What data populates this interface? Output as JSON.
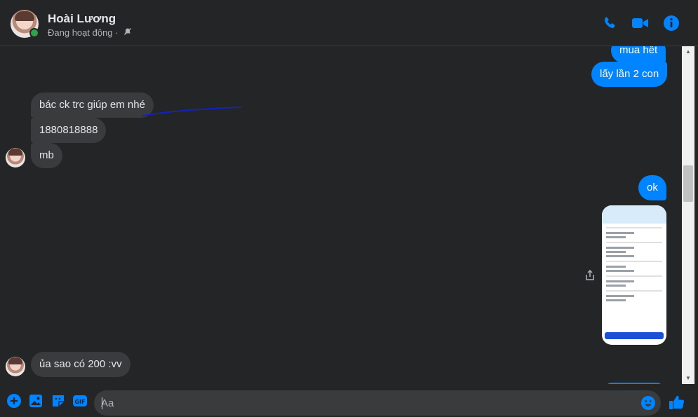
{
  "header": {
    "name": "Hoài Lương",
    "status": "Đang hoạt động ·",
    "icons": [
      "phone-icon",
      "video-camera-icon",
      "info-icon"
    ],
    "accent": "#0084ff"
  },
  "messages": [
    {
      "side": "out",
      "text": "mua hết"
    },
    {
      "side": "out",
      "text": "lấy lần 2 con"
    },
    {
      "side": "in",
      "text": "bác ck trc giúp em nhé"
    },
    {
      "side": "in",
      "text": "1880818888"
    },
    {
      "side": "in",
      "text": "mb"
    },
    {
      "side": "out",
      "text": "ok"
    },
    {
      "side": "in",
      "text": "ủa sao có 200 :vv"
    }
  ],
  "composer": {
    "placeholder": "Aa",
    "icons": [
      "plus-icon",
      "photo-icon",
      "sticker-icon",
      "gif-icon",
      "emoji-icon",
      "like-icon"
    ]
  }
}
